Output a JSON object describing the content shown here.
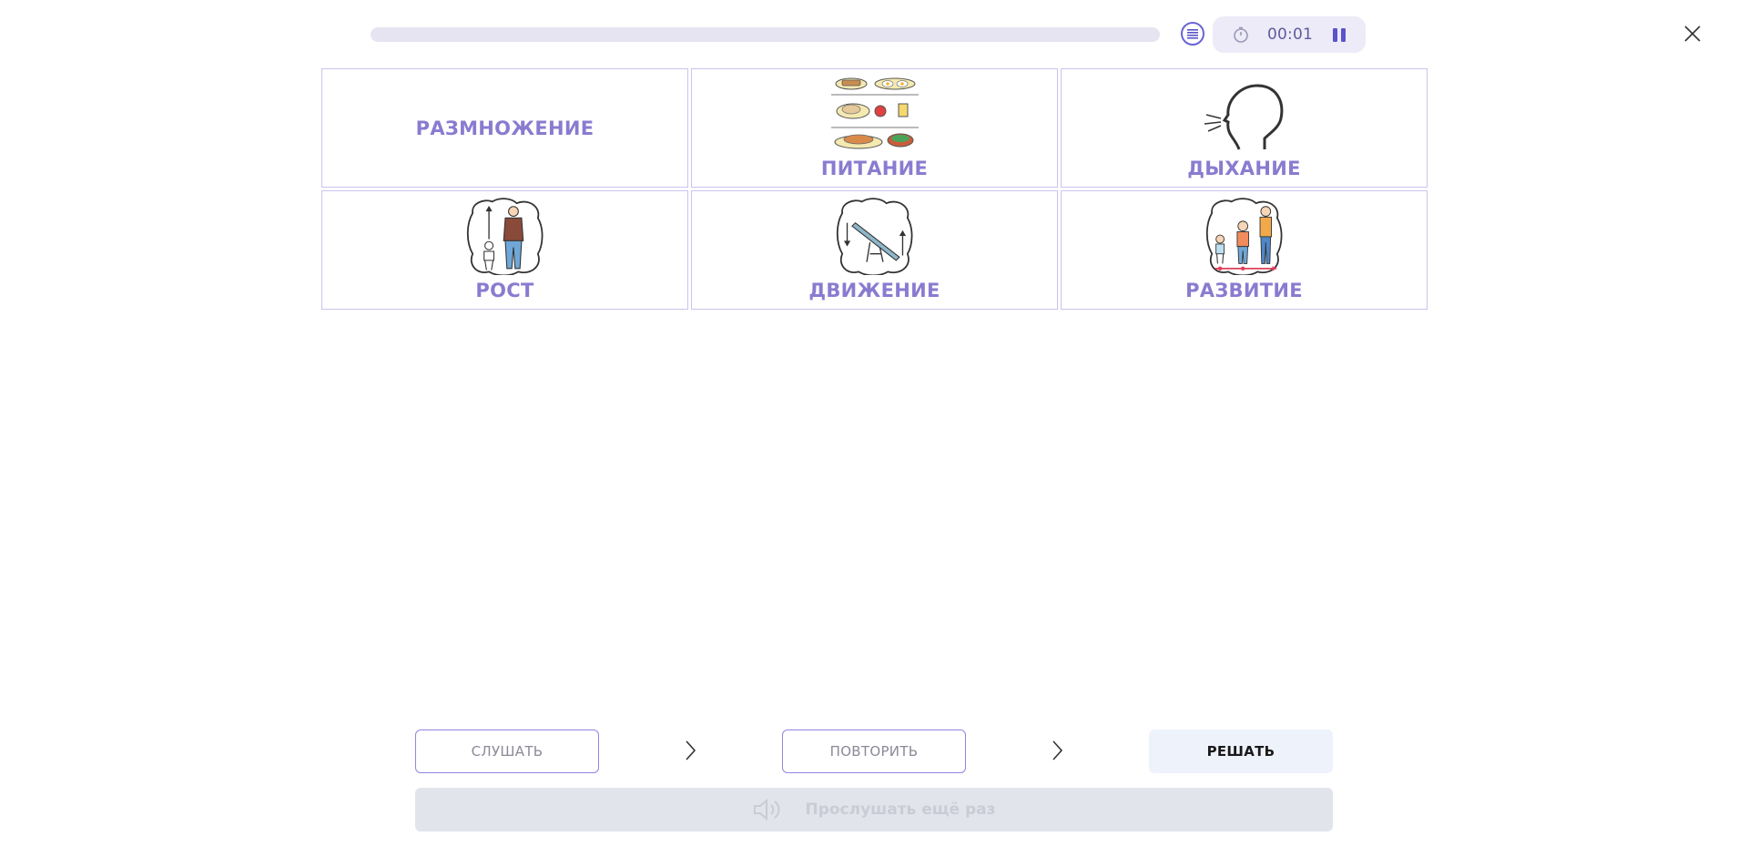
{
  "header": {
    "timer": "00:01"
  },
  "cards": [
    {
      "label": "РАЗМНОЖЕНИЕ",
      "icon": "none"
    },
    {
      "label": "ПИТАНИЕ",
      "icon": "food-icon"
    },
    {
      "label": "ДЫХАНИЕ",
      "icon": "breathing-head-icon"
    },
    {
      "label": "РОСТ",
      "icon": "growth-icon"
    },
    {
      "label": "ДВИЖЕНИЕ",
      "icon": "seesaw-icon"
    },
    {
      "label": "РАЗВИТИЕ",
      "icon": "development-icon"
    }
  ],
  "footer": {
    "listen_label": "СЛУШАТЬ",
    "repeat_label": "ПОВТОРИТЬ",
    "solve_label": "РЕШАТЬ",
    "replay_label": "Прослушать ещё раз"
  },
  "colors": {
    "accent": "#8a7bd0",
    "border": "#c9c4ee",
    "progress_track": "#e6e4f1",
    "timer_bg": "#ecebf7"
  }
}
